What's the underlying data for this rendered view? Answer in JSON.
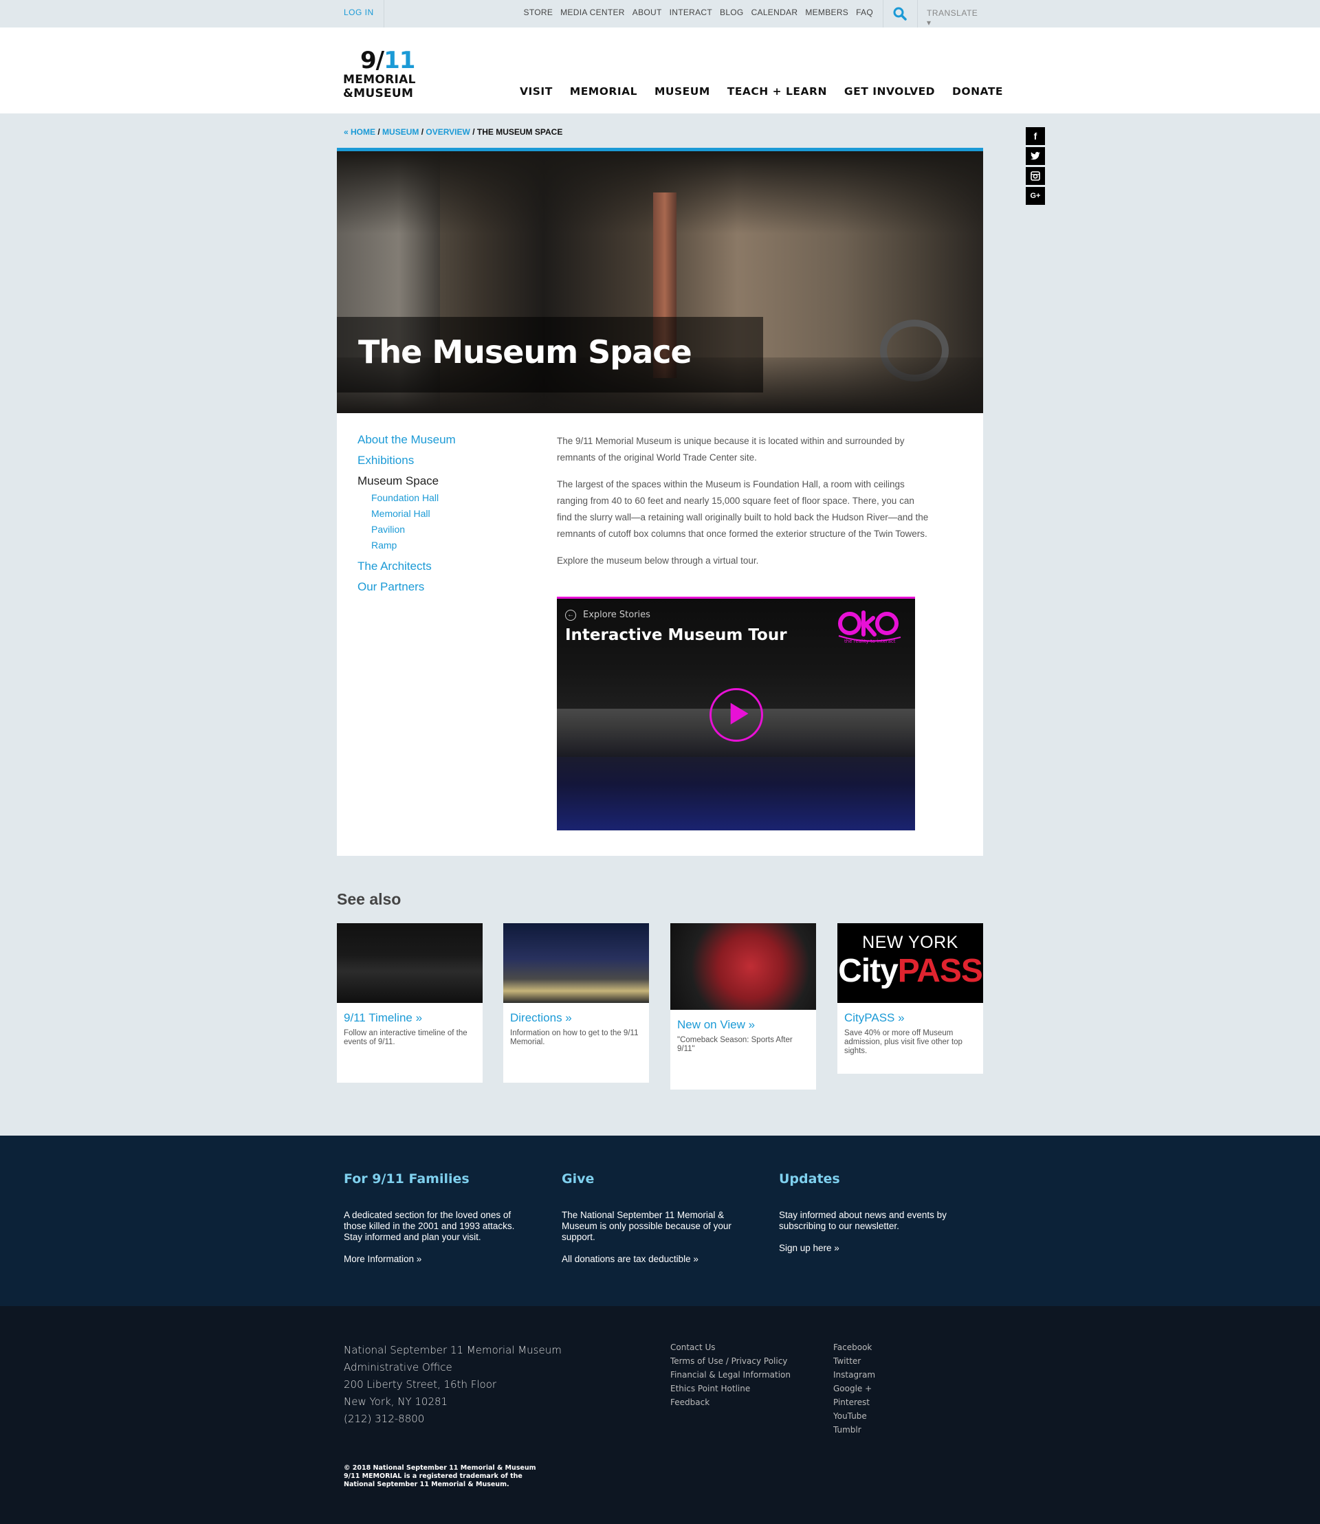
{
  "util": {
    "login": "LOG IN",
    "links": [
      "STORE",
      "MEDIA CENTER",
      "ABOUT",
      "INTERACT",
      "BLOG",
      "CALENDAR",
      "MEMBERS",
      "FAQ"
    ],
    "translate": "TRANSLATE ▾",
    "search_icon": "search-icon"
  },
  "logo": {
    "line1_a": "9/",
    "line1_b": "11",
    "line2": "MEMORIAL",
    "line3": "&MUSEUM"
  },
  "nav": [
    "VISIT",
    "MEMORIAL",
    "MUSEUM",
    "TEACH + LEARN",
    "GET INVOLVED",
    "DONATE"
  ],
  "breadcrumb": {
    "home": "« HOME",
    "museum": "MUSEUM",
    "overview": "OVERVIEW",
    "current": "THE MUSEUM SPACE",
    "sep": " / "
  },
  "social": [
    "f",
    "t",
    "ig",
    "G+"
  ],
  "hero": {
    "title": "The Museum Space"
  },
  "sidenav": {
    "about": "About the Museum",
    "exhibitions": "Exhibitions",
    "space": "Museum Space",
    "sub": [
      "Foundation Hall",
      "Memorial Hall",
      "Pavilion",
      "Ramp"
    ],
    "architects": "The Architects",
    "partners": "Our Partners"
  },
  "body": {
    "p1": "The 9/11 Memorial Museum is unique because it is located within and surrounded by remnants of the original World Trade Center site.",
    "p2": "The largest of the spaces within the Museum is Foundation Hall, a room with ceilings ranging from 40 to 60 feet and nearly 15,000 square feet of floor space. There, you can find the slurry wall—a retaining wall originally built to hold back the Hudson River—and the remnants of cutoff box columns that once formed the exterior structure of the Twin Towers.",
    "p3": "Explore the museum below through a virtual tour."
  },
  "tour": {
    "explore": "Explore Stories",
    "title": "Interactive Museum Tour",
    "logo_text": "oko",
    "logo_tag": "the reality to interact"
  },
  "seealso": {
    "title": "See also",
    "tiles": [
      {
        "title": "9/11 Timeline »",
        "desc": "Follow an interactive timeline of the events of 9/11."
      },
      {
        "title": "Directions »",
        "desc": "Information on how to get to the 9/11 Memorial."
      },
      {
        "title": "New on View »",
        "desc": "\"Comeback Season: Sports After 9/11\""
      },
      {
        "title": "CityPASS »",
        "desc": "Save 40% or more off Museum admission, plus visit five other top sights.",
        "img_line1": "NEW YORK",
        "img_city": "City",
        "img_pass": "PASS"
      }
    ]
  },
  "footer": {
    "families": {
      "title": "For 9/11 Families",
      "text": "A dedicated section for the loved ones of those killed in the 2001 and 1993 attacks. Stay informed and plan your visit.",
      "link": "More Information »"
    },
    "give": {
      "title": "Give",
      "text": "The National September 11 Memorial & Museum is only possible because of your support.",
      "link": "All donations are tax deductible »"
    },
    "updates": {
      "title": "Updates",
      "text": "Stay informed about news and events by subscribing to our newsletter.",
      "link": "Sign up here »"
    },
    "address": [
      "National September 11 Memorial Museum",
      "Administrative Office",
      "200 Liberty Street, 16th Floor",
      "New York, NY 10281",
      "(212) 312-8800"
    ],
    "links": [
      "Contact Us",
      "Terms of Use / Privacy Policy",
      "Financial & Legal Information",
      "Ethics Point Hotline",
      "Feedback"
    ],
    "socials": [
      "Facebook",
      "Twitter",
      "Instagram",
      "Google +",
      "Pinterest",
      "YouTube",
      "Tumblr"
    ],
    "copyright": [
      "© 2018 National September 11 Memorial & Museum",
      "9/11 MEMORIAL is a registered trademark of the",
      "National September 11 Memorial & Museum."
    ]
  }
}
